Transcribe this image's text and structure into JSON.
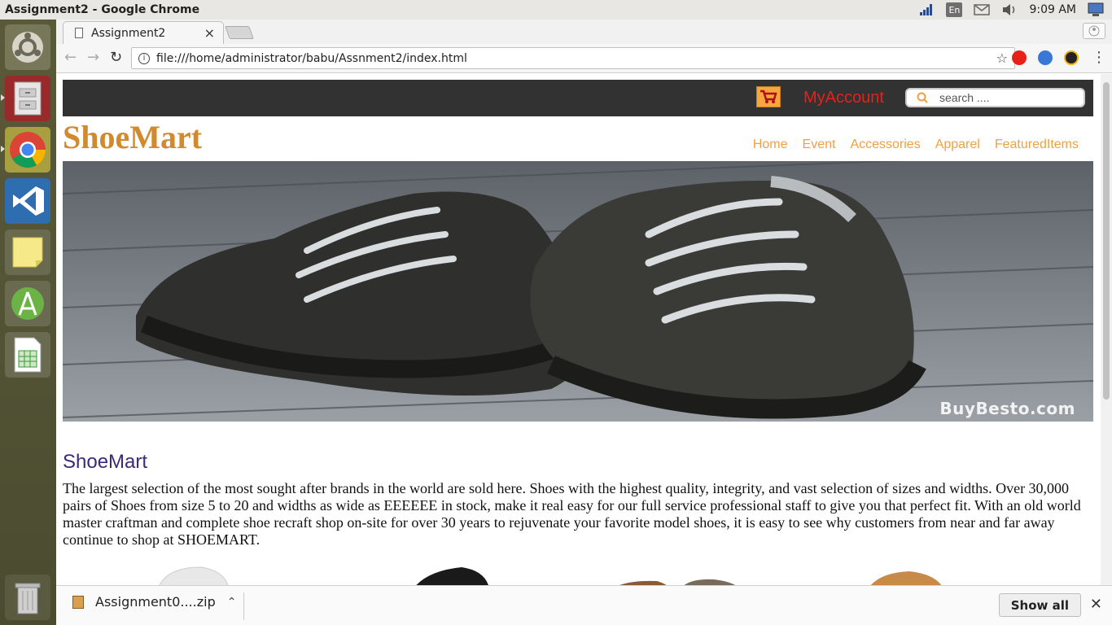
{
  "os": {
    "window_title": "Assignment2 - Google Chrome",
    "lang": "En",
    "time": "9:09 AM"
  },
  "browser": {
    "tab_title": "Assignment2",
    "tab_close": "×",
    "url": "file:///home/administrator/babu/Assnment2/index.html"
  },
  "site": {
    "my_account": "MyAccount",
    "search_placeholder": "search ....",
    "brand": "ShoeMart",
    "nav": [
      "Home",
      "Event",
      "Accessories",
      "Apparel",
      "FeaturedItems"
    ],
    "hero_watermark": "BuyBesto.com",
    "section_title": "ShoeMart",
    "description": "The largest selection of the most sought after brands in the world are sold here. Shoes with the highest quality, integrity, and vast selection of sizes and widths. Over 30,000 pairs of Shoes from size 5 to 20 and widths as wide as EEEEEE in stock, make it real easy for our full service professional staff to give you that perfect fit. With an old world master craftman and complete shoe recraft shop on-site for over 30 years to rejuvenate your favorite model shoes, it is easy to see why customers from near and far away continue to shop at SHOEMART."
  },
  "downloads": {
    "file": "Assignment0....zip",
    "show_all": "Show all",
    "close": "✕"
  },
  "colors": {
    "brand": "#d28a2e",
    "nav": "#f0a040",
    "account": "#e8201a",
    "topbar": "#323232",
    "heading": "#3b2a7a"
  }
}
